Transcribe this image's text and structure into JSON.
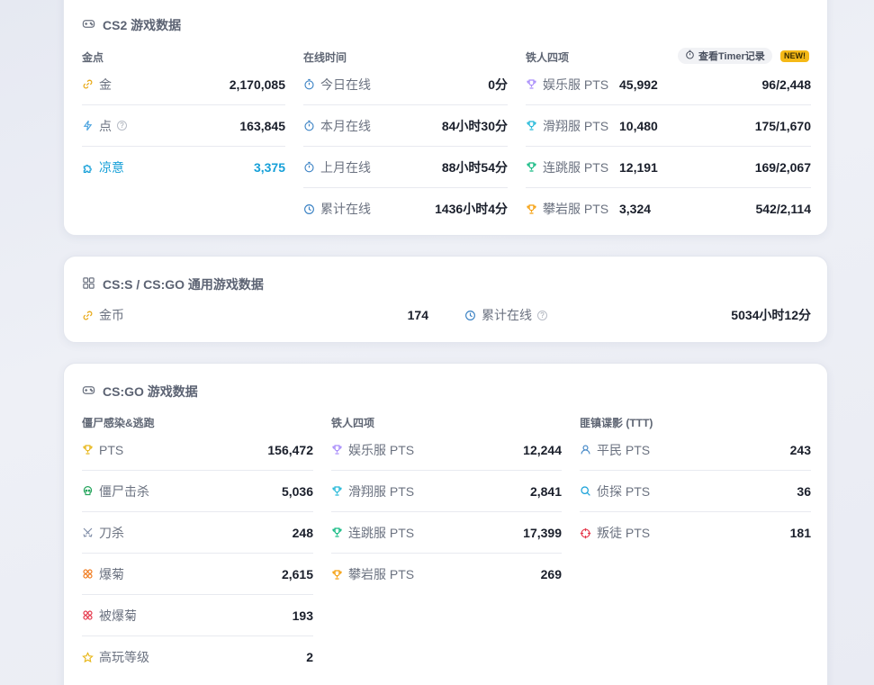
{
  "cs2": {
    "title": "CS2 游戏数据",
    "gold_section": {
      "header": "金点",
      "rows": [
        {
          "label": "金",
          "value": "2,170,085"
        },
        {
          "label": "点",
          "value": "163,845",
          "help": "?"
        },
        {
          "label": "凉意",
          "value": "3,375"
        }
      ]
    },
    "online_section": {
      "header": "在线时间",
      "rows": [
        {
          "label": "今日在线",
          "value": "0分"
        },
        {
          "label": "本月在线",
          "value": "84小时30分"
        },
        {
          "label": "上月在线",
          "value": "88小时54分"
        },
        {
          "label": "累计在线",
          "value": "1436小时4分"
        }
      ]
    },
    "iron_section": {
      "header": "铁人四项",
      "timer_button": "查看Timer记录",
      "new_badge": "NEW!",
      "rows": [
        {
          "label": "娱乐服 PTS",
          "pts": "45,992",
          "rank": "96/2,448",
          "color": "#a78bfa"
        },
        {
          "label": "滑翔服 PTS",
          "pts": "10,480",
          "rank": "175/1,670",
          "color": "#22b8d8"
        },
        {
          "label": "连跳服 PTS",
          "pts": "12,191",
          "rank": "169/2,067",
          "color": "#10b981"
        },
        {
          "label": "攀岩服 PTS",
          "pts": "3,324",
          "rank": "542/2,114",
          "color": "#f59e0b"
        }
      ]
    }
  },
  "css_csgo": {
    "title": "CS:S / CS:GO 通用游戏数据",
    "coins": {
      "label": "金币",
      "value": "174"
    },
    "online": {
      "label": "累计在线",
      "value": "5034小时12分",
      "help": "?"
    }
  },
  "csgo": {
    "title": "CS:GO 游戏数据",
    "zombie_section": {
      "header": "僵尸感染&逃跑",
      "rows": [
        {
          "label": "PTS",
          "value": "156,472"
        },
        {
          "label": "僵尸击杀",
          "value": "5,036"
        },
        {
          "label": "刀杀",
          "value": "248"
        },
        {
          "label": "爆菊",
          "value": "2,615"
        },
        {
          "label": "被爆菊",
          "value": "193"
        },
        {
          "label": "高玩等级",
          "value": "2"
        }
      ]
    },
    "iron_section": {
      "header": "铁人四项",
      "rows": [
        {
          "label": "娱乐服 PTS",
          "value": "12,244"
        },
        {
          "label": "滑翔服 PTS",
          "value": "2,841"
        },
        {
          "label": "连跳服 PTS",
          "value": "17,399"
        },
        {
          "label": "攀岩服 PTS",
          "value": "269"
        }
      ]
    },
    "ttt_section": {
      "header": "匪镇谍影 (TTT)",
      "rows": [
        {
          "label": "平民 PTS",
          "value": "243"
        },
        {
          "label": "侦探 PTS",
          "value": "36"
        },
        {
          "label": "叛徒 PTS",
          "value": "181"
        }
      ]
    }
  }
}
